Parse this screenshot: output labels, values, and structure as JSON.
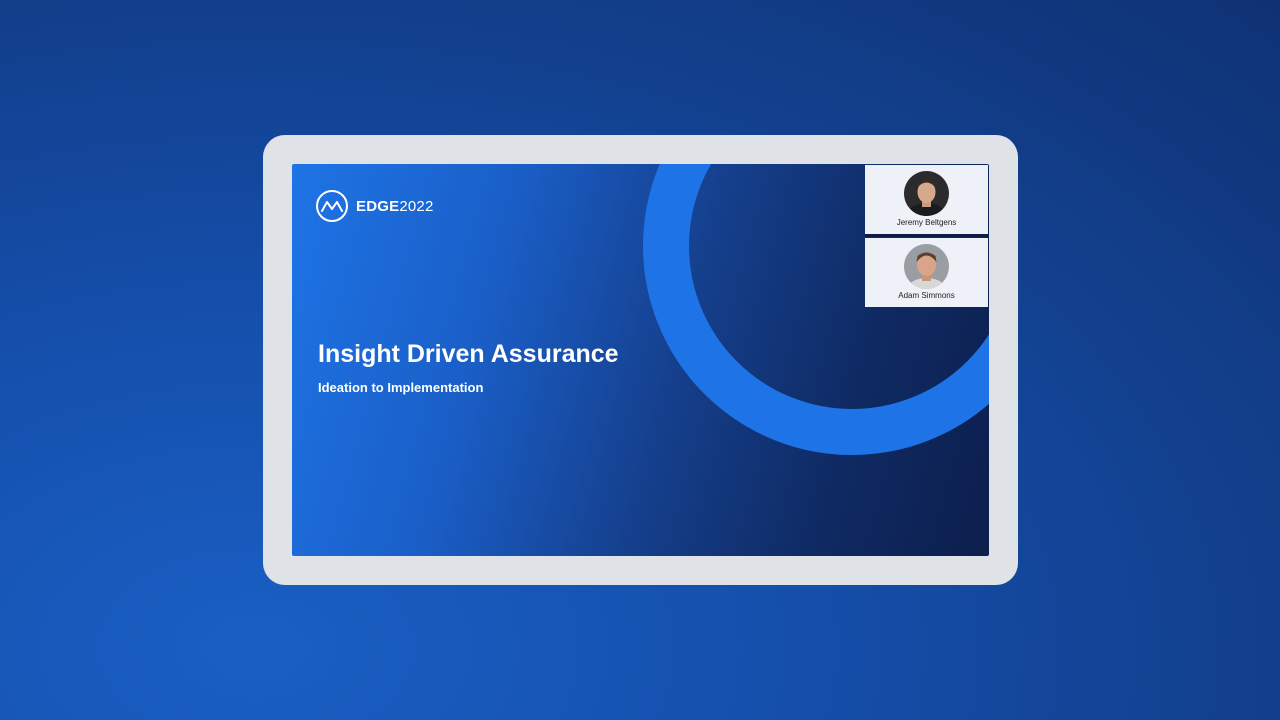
{
  "brand": {
    "logo_icon": "edge-logo-icon",
    "name_bold": "EDGE",
    "name_regular": "2022"
  },
  "slide": {
    "title": "Insight Driven Assurance",
    "subtitle": "Ideation to Implementation"
  },
  "participants": [
    {
      "name": "Jeremy Beltgens",
      "icon": "avatar-photo"
    },
    {
      "name": "Adam Simmons",
      "icon": "avatar-photo"
    }
  ],
  "colors": {
    "background": "#1550ad",
    "frame": "#dfe3e8",
    "accent_ring": "#1e74e6",
    "slide_dark": "#0c1f4d",
    "tile_bg": "#eef1f7"
  }
}
